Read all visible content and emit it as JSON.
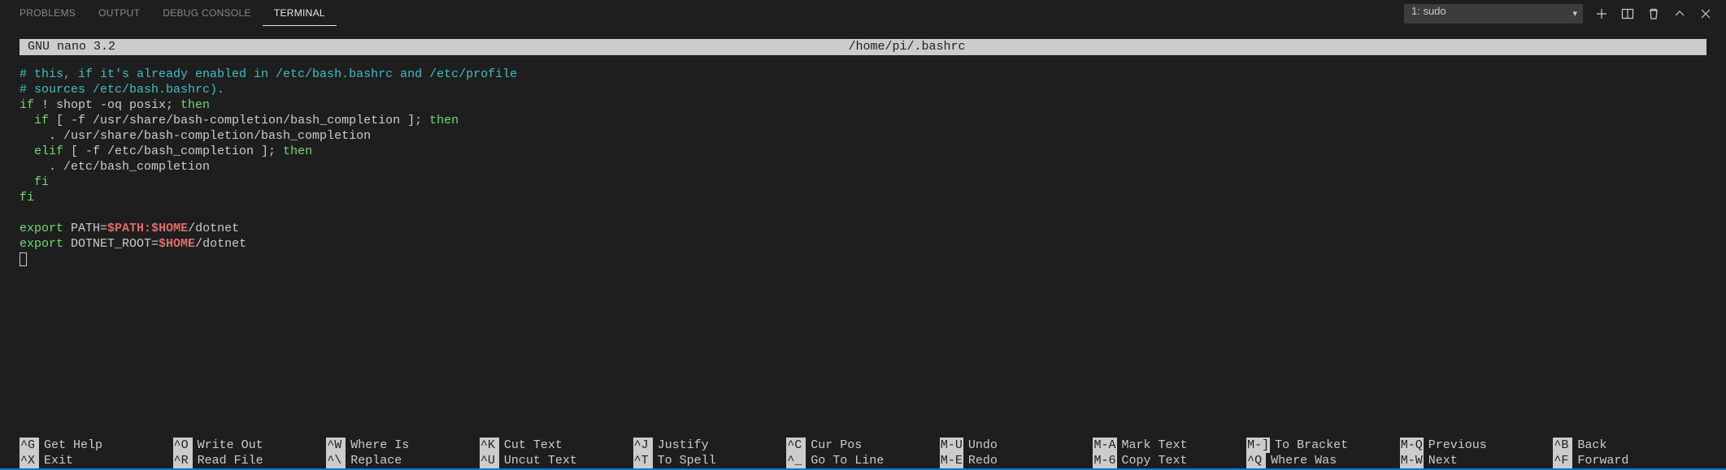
{
  "tabs": {
    "problems": "PROBLEMS",
    "output": "OUTPUT",
    "debug_console": "DEBUG CONSOLE",
    "terminal": "TERMINAL"
  },
  "terminal_select": {
    "label": "1: sudo"
  },
  "nano": {
    "version": "GNU nano 3.2",
    "filepath": "/home/pi/.bashrc"
  },
  "code": {
    "l1": "# this, if it's already enabled in /etc/bash.bashrc and /etc/profile",
    "l2": "# sources /etc/bash.bashrc).",
    "l3a": "if",
    "l3b": " ! shopt -oq posix; ",
    "l3c": "then",
    "l4a": "  if",
    "l4b": " [ -f /usr/share/bash-completion/bash_completion ]; ",
    "l4c": "then",
    "l5": "    . /usr/share/bash-completion/bash_completion",
    "l6a": "  elif",
    "l6b": " [ -f /etc/bash_completion ]; ",
    "l6c": "then",
    "l7": "    . /etc/bash_completion",
    "l8": "  fi",
    "l9": "fi",
    "l10a": "export",
    "l10b": " PATH=",
    "l10c": "$PATH",
    "l10d": ":",
    "l10e": "$HOME",
    "l10f": "/dotnet",
    "l11a": "export",
    "l11b": " DOTNET_ROOT=",
    "l11c": "$HOME",
    "l11d": "/dotnet"
  },
  "shortcuts": {
    "row1": [
      {
        "key": "^G",
        "label": "Get Help"
      },
      {
        "key": "^O",
        "label": "Write Out"
      },
      {
        "key": "^W",
        "label": "Where Is"
      },
      {
        "key": "^K",
        "label": "Cut Text"
      },
      {
        "key": "^J",
        "label": "Justify"
      },
      {
        "key": "^C",
        "label": "Cur Pos"
      },
      {
        "key": "M-U",
        "label": "Undo"
      },
      {
        "key": "M-A",
        "label": "Mark Text"
      },
      {
        "key": "M-]",
        "label": "To Bracket"
      },
      {
        "key": "M-Q",
        "label": "Previous"
      },
      {
        "key": "^B",
        "label": "Back"
      }
    ],
    "row2": [
      {
        "key": "^X",
        "label": "Exit"
      },
      {
        "key": "^R",
        "label": "Read File"
      },
      {
        "key": "^\\",
        "label": "Replace"
      },
      {
        "key": "^U",
        "label": "Uncut Text"
      },
      {
        "key": "^T",
        "label": "To Spell"
      },
      {
        "key": "^_",
        "label": "Go To Line"
      },
      {
        "key": "M-E",
        "label": "Redo"
      },
      {
        "key": "M-6",
        "label": "Copy Text"
      },
      {
        "key": "^Q",
        "label": "Where Was"
      },
      {
        "key": "M-W",
        "label": "Next"
      },
      {
        "key": "^F",
        "label": "Forward"
      }
    ]
  }
}
